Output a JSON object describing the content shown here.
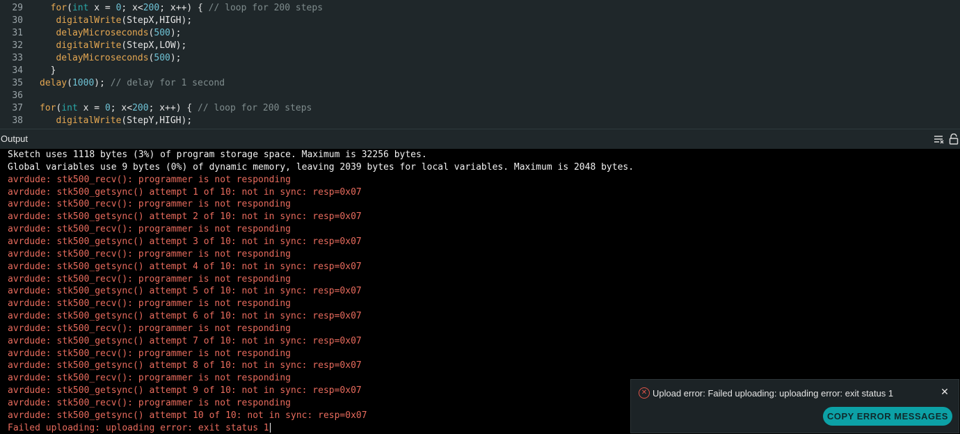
{
  "editor": {
    "lines": [
      {
        "num": "29",
        "indent": "  ",
        "tokens": [
          {
            "t": "for",
            "c": "kw"
          },
          {
            "t": "(",
            "c": "txt"
          },
          {
            "t": "int",
            "c": "type"
          },
          {
            "t": " x = ",
            "c": "txt"
          },
          {
            "t": "0",
            "c": "num"
          },
          {
            "t": "; x<",
            "c": "txt"
          },
          {
            "t": "200",
            "c": "num"
          },
          {
            "t": "; x++) { ",
            "c": "txt"
          },
          {
            "t": "// loop for 200 steps",
            "c": "cm"
          }
        ]
      },
      {
        "num": "30",
        "indent": "   ",
        "tokens": [
          {
            "t": "digitalWrite",
            "c": "fn"
          },
          {
            "t": "(StepX,HIGH);",
            "c": "txt"
          }
        ]
      },
      {
        "num": "31",
        "indent": "   ",
        "tokens": [
          {
            "t": "delayMicroseconds",
            "c": "fn"
          },
          {
            "t": "(",
            "c": "txt"
          },
          {
            "t": "500",
            "c": "num"
          },
          {
            "t": ");",
            "c": "txt"
          }
        ]
      },
      {
        "num": "32",
        "indent": "   ",
        "tokens": [
          {
            "t": "digitalWrite",
            "c": "fn"
          },
          {
            "t": "(StepX,LOW);",
            "c": "txt"
          }
        ]
      },
      {
        "num": "33",
        "indent": "   ",
        "tokens": [
          {
            "t": "delayMicroseconds",
            "c": "fn"
          },
          {
            "t": "(",
            "c": "txt"
          },
          {
            "t": "500",
            "c": "num"
          },
          {
            "t": ");",
            "c": "txt"
          }
        ]
      },
      {
        "num": "34",
        "indent": "  ",
        "tokens": [
          {
            "t": "}",
            "c": "txt"
          }
        ]
      },
      {
        "num": "35",
        "indent": "",
        "tokens": [
          {
            "t": "delay",
            "c": "fn"
          },
          {
            "t": "(",
            "c": "txt"
          },
          {
            "t": "1000",
            "c": "num"
          },
          {
            "t": "); ",
            "c": "txt"
          },
          {
            "t": "// delay for 1 second",
            "c": "cm"
          }
        ]
      },
      {
        "num": "36",
        "indent": "",
        "tokens": []
      },
      {
        "num": "37",
        "indent": "",
        "tokens": [
          {
            "t": "for",
            "c": "kw"
          },
          {
            "t": "(",
            "c": "txt"
          },
          {
            "t": "int",
            "c": "type"
          },
          {
            "t": " x = ",
            "c": "txt"
          },
          {
            "t": "0",
            "c": "num"
          },
          {
            "t": "; x<",
            "c": "txt"
          },
          {
            "t": "200",
            "c": "num"
          },
          {
            "t": "; x++) { ",
            "c": "txt"
          },
          {
            "t": "// loop for 200 steps",
            "c": "cm"
          }
        ]
      },
      {
        "num": "38",
        "indent": "   ",
        "tokens": [
          {
            "t": "digitalWrite",
            "c": "fn"
          },
          {
            "t": "(StepY,HIGH);",
            "c": "txt"
          }
        ]
      }
    ]
  },
  "output": {
    "title": "Output",
    "icons": [
      "clear-output-icon",
      "lock-scroll-icon"
    ],
    "lines": [
      {
        "text": "Sketch uses 1118 bytes (3%) of program storage space. Maximum is 32256 bytes.",
        "kind": "normal"
      },
      {
        "text": "Global variables use 9 bytes (0%) of dynamic memory, leaving 2039 bytes for local variables. Maximum is 2048 bytes.",
        "kind": "normal"
      },
      {
        "text": "avrdude: stk500_recv(): programmer is not responding",
        "kind": "error"
      },
      {
        "text": "avrdude: stk500_getsync() attempt 1 of 10: not in sync: resp=0x07",
        "kind": "error"
      },
      {
        "text": "avrdude: stk500_recv(): programmer is not responding",
        "kind": "error"
      },
      {
        "text": "avrdude: stk500_getsync() attempt 2 of 10: not in sync: resp=0x07",
        "kind": "error"
      },
      {
        "text": "avrdude: stk500_recv(): programmer is not responding",
        "kind": "error"
      },
      {
        "text": "avrdude: stk500_getsync() attempt 3 of 10: not in sync: resp=0x07",
        "kind": "error"
      },
      {
        "text": "avrdude: stk500_recv(): programmer is not responding",
        "kind": "error"
      },
      {
        "text": "avrdude: stk500_getsync() attempt 4 of 10: not in sync: resp=0x07",
        "kind": "error"
      },
      {
        "text": "avrdude: stk500_recv(): programmer is not responding",
        "kind": "error"
      },
      {
        "text": "avrdude: stk500_getsync() attempt 5 of 10: not in sync: resp=0x07",
        "kind": "error"
      },
      {
        "text": "avrdude: stk500_recv(): programmer is not responding",
        "kind": "error"
      },
      {
        "text": "avrdude: stk500_getsync() attempt 6 of 10: not in sync: resp=0x07",
        "kind": "error"
      },
      {
        "text": "avrdude: stk500_recv(): programmer is not responding",
        "kind": "error"
      },
      {
        "text": "avrdude: stk500_getsync() attempt 7 of 10: not in sync: resp=0x07",
        "kind": "error"
      },
      {
        "text": "avrdude: stk500_recv(): programmer is not responding",
        "kind": "error"
      },
      {
        "text": "avrdude: stk500_getsync() attempt 8 of 10: not in sync: resp=0x07",
        "kind": "error"
      },
      {
        "text": "avrdude: stk500_recv(): programmer is not responding",
        "kind": "error"
      },
      {
        "text": "avrdude: stk500_getsync() attempt 9 of 10: not in sync: resp=0x07",
        "kind": "error"
      },
      {
        "text": "avrdude: stk500_recv(): programmer is not responding",
        "kind": "error"
      },
      {
        "text": "avrdude: stk500_getsync() attempt 10 of 10: not in sync: resp=0x07",
        "kind": "error"
      },
      {
        "text": "Failed uploading: uploading error: exit status 1",
        "kind": "error"
      }
    ]
  },
  "notification": {
    "icon": "error-circle-icon",
    "message": "Upload error: Failed uploading: uploading error: exit status 1",
    "close_icon": "close-icon",
    "button_label": "COPY ERROR MESSAGES"
  },
  "colors": {
    "editor_bg": "#1f272a",
    "output_bg": "#000000",
    "error_text": "#e86b5d",
    "normal_text": "#f2f2f2",
    "accent": "#0ca1a6"
  }
}
